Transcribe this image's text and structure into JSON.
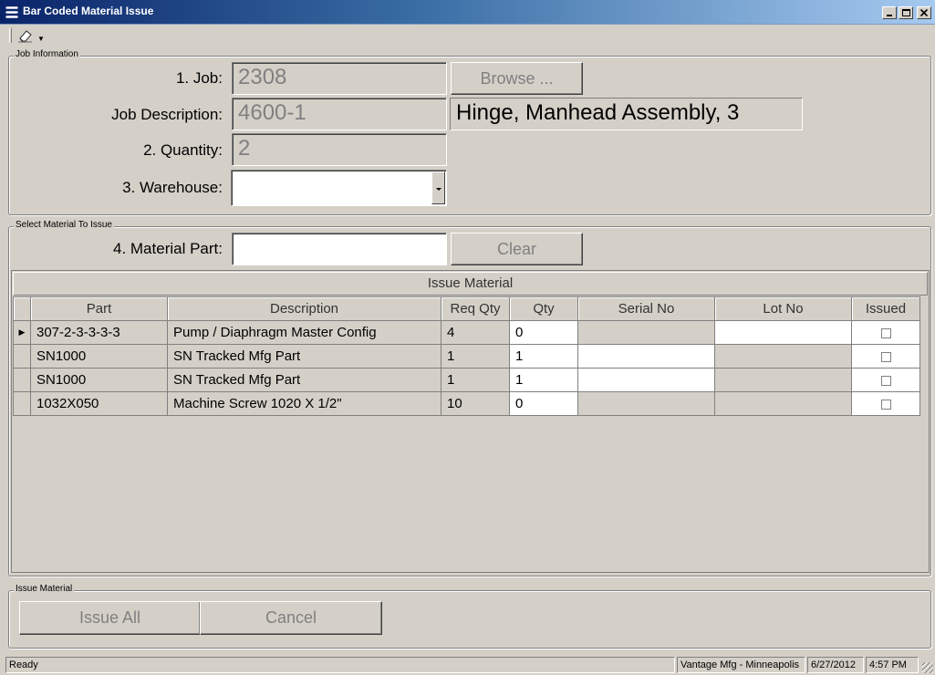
{
  "window": {
    "title": "Bar Coded Material Issue",
    "controls": [
      "minimize",
      "maximize",
      "close"
    ]
  },
  "toolbar": {
    "eraser_icon": "eraser-icon",
    "dropdown_icon": "dropdown-arrow-icon"
  },
  "job_info": {
    "group_label": "Job Information",
    "job_label": "1.  Job:",
    "job_value": "2308",
    "browse_label": "Browse ...",
    "job_description_label": "Job Description:",
    "job_description_value": "4600-1",
    "job_description_text": "Hinge, Manhead Assembly, 3",
    "quantity_label": "2.  Quantity:",
    "quantity_value": "2",
    "warehouse_label": "3.  Warehouse:",
    "warehouse_value": ""
  },
  "select_material": {
    "group_label": "Select Material To Issue",
    "material_part_label": "4.  Material Part:",
    "material_part_value": "",
    "clear_label": "Clear"
  },
  "grid": {
    "caption": "Issue Material",
    "columns": [
      "Part",
      "Description",
      "Req Qty",
      "Qty",
      "Serial No",
      "Lot No",
      "Issued"
    ],
    "rows": [
      {
        "part": "307-2-3-3-3-3",
        "description": "Pump / Diaphragm Master Config",
        "req_qty": "4",
        "qty": "0",
        "serial_no": "",
        "lot_no": "",
        "issued": false,
        "current": true
      },
      {
        "part": "SN1000",
        "description": "SN Tracked Mfg Part",
        "req_qty": "1",
        "qty": "1",
        "serial_no": "",
        "lot_no": "",
        "issued": false,
        "current": false
      },
      {
        "part": "SN1000",
        "description": "SN Tracked Mfg Part",
        "req_qty": "1",
        "qty": "1",
        "serial_no": "",
        "lot_no": "",
        "issued": false,
        "current": false
      },
      {
        "part": "1032X050",
        "description": "Machine Screw 1020 X 1/2\"",
        "req_qty": "10",
        "qty": "0",
        "serial_no": "",
        "lot_no": "",
        "issued": false,
        "current": false
      }
    ]
  },
  "issue_material": {
    "group_label": "Issue Material",
    "issue_all_label": "Issue All",
    "cancel_label": "Cancel"
  },
  "status": {
    "message": "Ready",
    "company": "Vantage Mfg - Minneapolis",
    "date": "6/27/2012",
    "time": "4:57 PM"
  }
}
